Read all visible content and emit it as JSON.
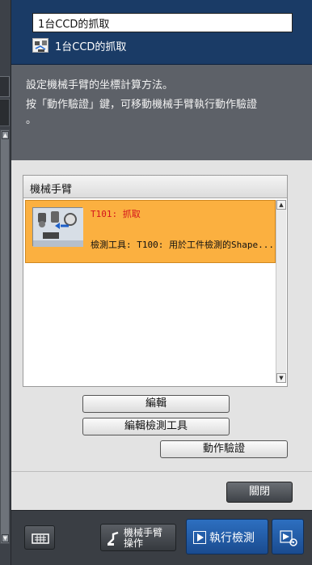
{
  "header": {
    "name_value": "1台CCD的抓取",
    "sub_label": "1台CCD的抓取"
  },
  "description": {
    "line1": "設定機械手臂的坐標計算方法。",
    "line2": "按「動作驗證」鍵，可移動機械手臂執行動作驗證",
    "line3": "。"
  },
  "robot_group": {
    "title": "機械手臂",
    "items": [
      {
        "line1": "T101: 抓取",
        "line2": "檢測工具: T100: 用於工件檢測的Shape..."
      }
    ]
  },
  "buttons": {
    "edit": "編輯",
    "edit_tool": "編輯檢測工具",
    "verify": "動作驗證",
    "close": "關閉"
  },
  "bottom_bar": {
    "arm_label_line1": "機械手臂",
    "arm_label_line2": "操作",
    "run_label": "執行檢測"
  },
  "colors": {
    "header_bg": "#1a3b66",
    "selected_row": "#fbb040",
    "run_button": "#2d6fc0"
  }
}
